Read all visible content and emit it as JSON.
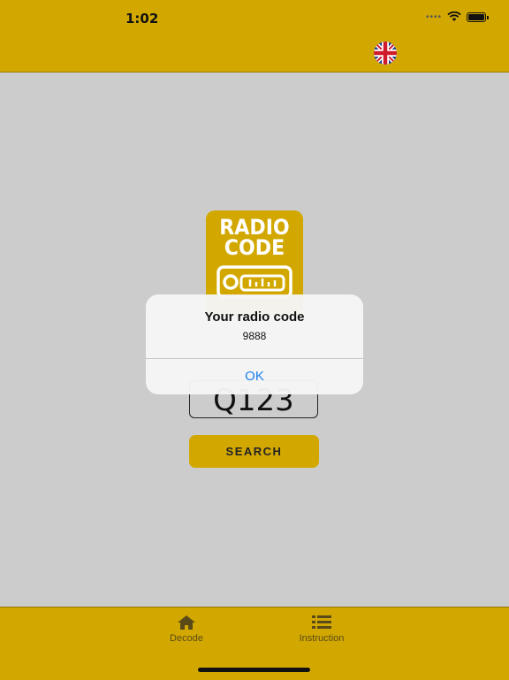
{
  "status_bar": {
    "time": "1:02",
    "dots": "••••"
  },
  "header": {
    "language_flag": "uk-flag-icon"
  },
  "logo": {
    "line1": "RADIO",
    "line2": "CODE"
  },
  "form": {
    "serial_value": "Q123",
    "search_label": "SEARCH"
  },
  "alert": {
    "title": "Your radio code",
    "message": "9888",
    "ok_label": "OK"
  },
  "tabbar": {
    "items": [
      {
        "label": "Decode",
        "icon": "home-icon"
      },
      {
        "label": "Instruction",
        "icon": "list-icon"
      }
    ]
  },
  "colors": {
    "accent": "#d2a800",
    "background": "#cccccc",
    "link": "#1a7ef2"
  }
}
